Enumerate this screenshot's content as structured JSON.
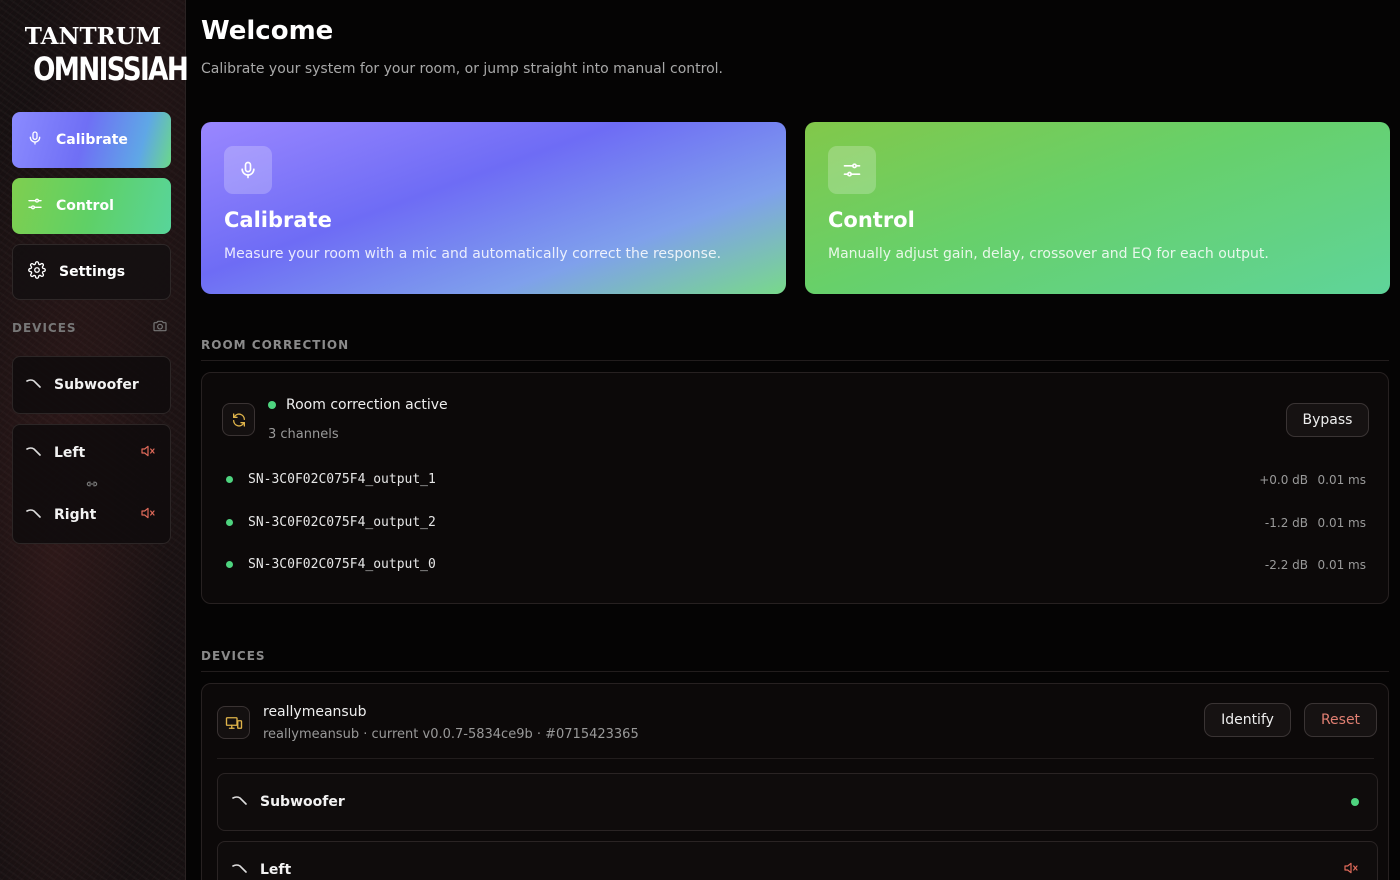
{
  "logo": {
    "line1": "TANTRUM",
    "line2": "OMNISSIAH"
  },
  "nav": {
    "calibrate": "Calibrate",
    "control": "Control",
    "settings": "Settings"
  },
  "sidebar_devices": {
    "header": "DEVICES",
    "items": [
      {
        "name": "Subwoofer",
        "status": "online"
      },
      {
        "name": "Left",
        "status": "muted"
      },
      {
        "name": "Right",
        "status": "muted"
      }
    ]
  },
  "welcome": {
    "title": "Welcome",
    "subtitle": "Calibrate your system for your room, or jump straight into manual control."
  },
  "hero": {
    "calibrate": {
      "title": "Calibrate",
      "desc": "Measure your room with a mic and automatically correct the response."
    },
    "control": {
      "title": "Control",
      "desc": "Manually adjust gain, delay, crossover and EQ for each output."
    }
  },
  "room_correction": {
    "section_label": "ROOM CORRECTION",
    "status": "Room correction active",
    "channels_count": "3 channels",
    "bypass_label": "Bypass",
    "channels": [
      {
        "name": "SN-3C0F02C075F4_output_1",
        "gain": "+0.0 dB",
        "delay": "0.01 ms"
      },
      {
        "name": "SN-3C0F02C075F4_output_2",
        "gain": "-1.2 dB",
        "delay": "0.01 ms"
      },
      {
        "name": "SN-3C0F02C075F4_output_0",
        "gain": "-2.2 dB",
        "delay": "0.01 ms"
      }
    ]
  },
  "devices_section": {
    "section_label": "DEVICES",
    "device": {
      "name": "reallymeansub",
      "meta": "reallymeansub · current v0.0.7-5834ce9b · #0715423365",
      "identify_label": "Identify",
      "reset_label": "Reset"
    },
    "outputs": [
      {
        "name": "Subwoofer",
        "status": "online"
      },
      {
        "name": "Left",
        "status": "muted"
      }
    ]
  },
  "colors": {
    "online": "#4ed47f",
    "muted": "#e06a5a",
    "reset": "#e07f72"
  }
}
